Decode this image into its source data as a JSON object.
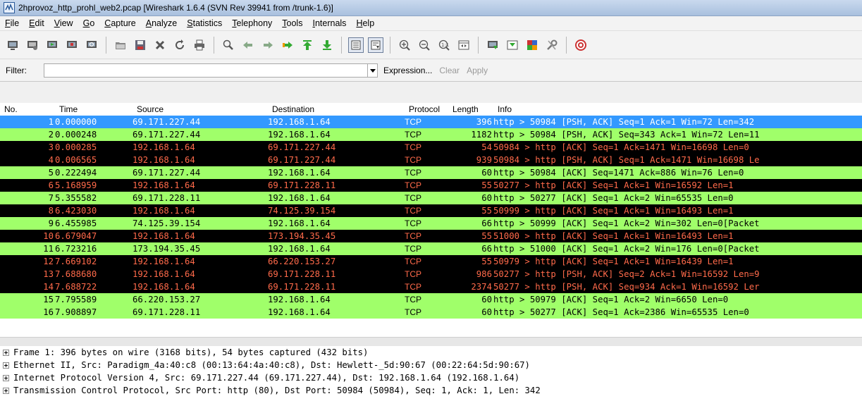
{
  "window": {
    "title": "2hprovoz_http_prohl_web2.pcap  [Wireshark 1.6.4  (SVN Rev 39941 from /trunk-1.6)]"
  },
  "menu": [
    "File",
    "Edit",
    "View",
    "Go",
    "Capture",
    "Analyze",
    "Statistics",
    "Telephony",
    "Tools",
    "Internals",
    "Help"
  ],
  "toolbar_icons": [
    "interface-list-icon",
    "capture-options-icon",
    "start-capture-icon",
    "stop-capture-icon",
    "restart-capture-icon",
    "sep",
    "open-file-icon",
    "save-file-icon",
    "close-file-icon",
    "reload-icon",
    "print-icon",
    "sep",
    "find-packet-icon",
    "go-back-icon",
    "go-forward-icon",
    "go-to-packet-icon",
    "go-first-icon",
    "go-last-icon",
    "sep",
    "colorize-icon",
    "auto-scroll-icon",
    "sep",
    "zoom-in-icon",
    "zoom-out-icon",
    "normal-size-icon",
    "resize-columns-icon",
    "sep",
    "capture-filters-icon",
    "display-filters-icon",
    "coloring-rules-icon",
    "preferences-icon",
    "sep",
    "help-icon"
  ],
  "filter": {
    "label": "Filter:",
    "value": "",
    "expression": "Expression...",
    "clear": "Clear",
    "apply": "Apply"
  },
  "columns": {
    "no": "No.",
    "time": "Time",
    "source": "Source",
    "destination": "Destination",
    "protocol": "Protocol",
    "length": "Length",
    "info": "Info"
  },
  "packets": [
    {
      "no": "1",
      "time": "0.000000",
      "src": "69.171.227.44",
      "dst": "192.168.1.64",
      "proto": "TCP",
      "len": "396",
      "info": "http > 50984 [PSH, ACK] Seq=1 Ack=1 Win=72 Len=342",
      "style": "selected"
    },
    {
      "no": "2",
      "time": "0.000248",
      "src": "69.171.227.44",
      "dst": "192.168.1.64",
      "proto": "TCP",
      "len": "1182",
      "info": "http > 50984 [PSH, ACK] Seq=343 Ack=1 Win=72 Len=11",
      "style": "green"
    },
    {
      "no": "3",
      "time": "0.000285",
      "src": "192.168.1.64",
      "dst": "69.171.227.44",
      "proto": "TCP",
      "len": "54",
      "info": "50984 > http [ACK] Seq=1 Ack=1471 Win=16698 Len=0",
      "style": "black"
    },
    {
      "no": "4",
      "time": "0.006565",
      "src": "192.168.1.64",
      "dst": "69.171.227.44",
      "proto": "TCP",
      "len": "939",
      "info": "50984 > http [PSH, ACK] Seq=1 Ack=1471 Win=16698 Le",
      "style": "black"
    },
    {
      "no": "5",
      "time": "0.222494",
      "src": "69.171.227.44",
      "dst": "192.168.1.64",
      "proto": "TCP",
      "len": "60",
      "info": "http > 50984 [ACK] Seq=1471 Ack=886 Win=76 Len=0",
      "style": "green"
    },
    {
      "no": "6",
      "time": "5.168959",
      "src": "192.168.1.64",
      "dst": "69.171.228.11",
      "proto": "TCP",
      "len": "55",
      "info": "50277 > http [ACK] Seq=1 Ack=1 Win=16592 Len=1",
      "style": "black"
    },
    {
      "no": "7",
      "time": "5.355582",
      "src": "69.171.228.11",
      "dst": "192.168.1.64",
      "proto": "TCP",
      "len": "60",
      "info": "http > 50277 [ACK] Seq=1 Ack=2 Win=65535 Len=0",
      "style": "green"
    },
    {
      "no": "8",
      "time": "6.423030",
      "src": "192.168.1.64",
      "dst": "74.125.39.154",
      "proto": "TCP",
      "len": "55",
      "info": "50999 > http [ACK] Seq=1 Ack=1 Win=16493 Len=1",
      "style": "black"
    },
    {
      "no": "9",
      "time": "6.455985",
      "src": "74.125.39.154",
      "dst": "192.168.1.64",
      "proto": "TCP",
      "len": "66",
      "info": "http > 50999 [ACK] Seq=1 Ack=2 Win=302 Len=0[Packet",
      "style": "green"
    },
    {
      "no": "10",
      "time": "6.679047",
      "src": "192.168.1.64",
      "dst": "173.194.35.45",
      "proto": "TCP",
      "len": "55",
      "info": "51000 > http [ACK] Seq=1 Ack=1 Win=16493 Len=1",
      "style": "black"
    },
    {
      "no": "11",
      "time": "6.723216",
      "src": "173.194.35.45",
      "dst": "192.168.1.64",
      "proto": "TCP",
      "len": "66",
      "info": "http > 51000 [ACK] Seq=1 Ack=2 Win=176 Len=0[Packet",
      "style": "green"
    },
    {
      "no": "12",
      "time": "7.669102",
      "src": "192.168.1.64",
      "dst": "66.220.153.27",
      "proto": "TCP",
      "len": "55",
      "info": "50979 > http [ACK] Seq=1 Ack=1 Win=16439 Len=1",
      "style": "black"
    },
    {
      "no": "13",
      "time": "7.688680",
      "src": "192.168.1.64",
      "dst": "69.171.228.11",
      "proto": "TCP",
      "len": "986",
      "info": "50277 > http [PSH, ACK] Seq=2 Ack=1 Win=16592 Len=9",
      "style": "black"
    },
    {
      "no": "14",
      "time": "7.688722",
      "src": "192.168.1.64",
      "dst": "69.171.228.11",
      "proto": "TCP",
      "len": "2374",
      "info": "50277 > http [PSH, ACK] Seq=934 Ack=1 Win=16592 Ler",
      "style": "black"
    },
    {
      "no": "15",
      "time": "7.795589",
      "src": "66.220.153.27",
      "dst": "192.168.1.64",
      "proto": "TCP",
      "len": "60",
      "info": "http > 50979 [ACK] Seq=1 Ack=2 Win=6650 Len=0",
      "style": "green"
    },
    {
      "no": "16",
      "time": "7.908897",
      "src": "69.171.228.11",
      "dst": "192.168.1.64",
      "proto": "TCP",
      "len": "60",
      "info": "http > 50277 [ACK] Seq=1 Ack=2386 Win=65535 Len=0",
      "style": "green"
    }
  ],
  "details": [
    "Frame 1: 396 bytes on wire (3168 bits), 54 bytes captured (432 bits)",
    "Ethernet II, Src: Paradigm_4a:40:c8 (00:13:64:4a:40:c8), Dst: Hewlett-_5d:90:67 (00:22:64:5d:90:67)",
    "Internet Protocol Version 4, Src: 69.171.227.44 (69.171.227.44), Dst: 192.168.1.64 (192.168.1.64)",
    "Transmission Control Protocol, Src Port: http (80), Dst Port: 50984 (50984), Seq: 1, Ack: 1, Len: 342"
  ],
  "colors": {
    "green_row": "#a0ff6a",
    "black_row": "#000000",
    "black_row_text": "#ff6a4a",
    "selected_row": "#3399ff"
  }
}
